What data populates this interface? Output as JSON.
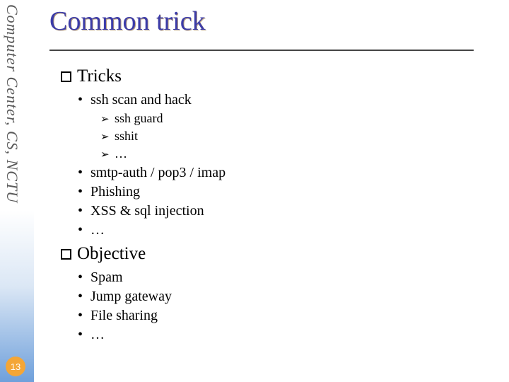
{
  "sidebar": {
    "vertical_label": "Computer Center, CS, NCTU",
    "page_number": "13"
  },
  "title": "Common trick",
  "sections": [
    {
      "heading": "Tricks",
      "bullets": [
        {
          "text": "ssh scan and hack",
          "sub": [
            "ssh guard",
            "sshit",
            "…"
          ]
        },
        {
          "text": "smtp-auth / pop3 / imap"
        },
        {
          "text": "Phishing"
        },
        {
          "text": "XSS & sql injection"
        },
        {
          "text": "…"
        }
      ]
    },
    {
      "heading": "Objective",
      "bullets": [
        {
          "text": "Spam"
        },
        {
          "text": "Jump gateway"
        },
        {
          "text": "File sharing"
        },
        {
          "text": "…"
        }
      ]
    }
  ]
}
